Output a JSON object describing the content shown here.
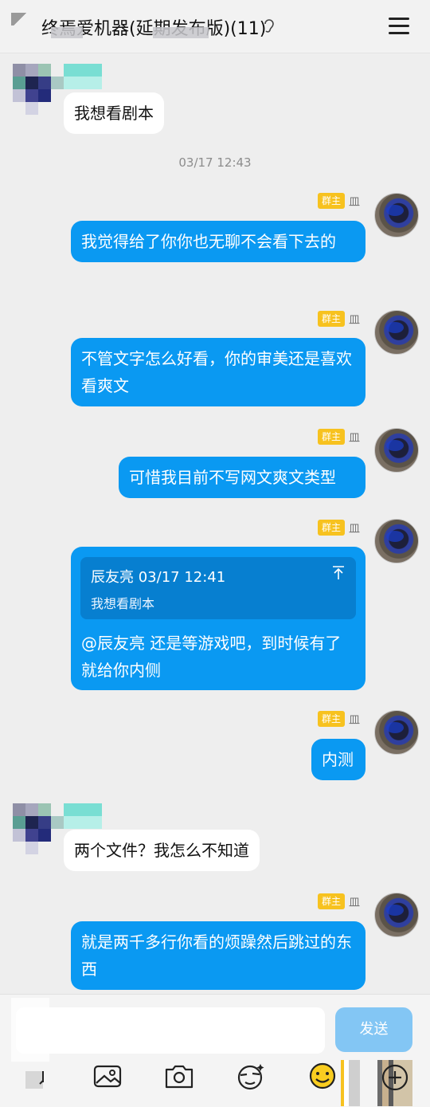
{
  "header": {
    "title": "终焉爱机器(延期发布版)(11)",
    "ear_icon": "ear-icon",
    "menu_icon": "hamburger-menu-icon"
  },
  "timestamp": "03/17 12:43",
  "owner_badge": "群主",
  "owner_nick": "皿",
  "messages": [
    {
      "side": "in",
      "text": "我想看剧本"
    },
    {
      "side": "out",
      "text": "我觉得给了你你也无聊不会看下去的"
    },
    {
      "side": "out",
      "text": "不管文字怎么好看，你的审美还是喜欢看爽文"
    },
    {
      "side": "out",
      "text": "可惜我目前不写网文爽文类型"
    },
    {
      "side": "out",
      "text": "@辰友亮 还是等游戏吧，到时候有了就给你内侧",
      "quote": {
        "author_time": "辰友亮 03/17 12:41",
        "text": "我想看剧本"
      }
    },
    {
      "side": "out",
      "text": "内测"
    },
    {
      "side": "in",
      "text": "两个文件？我怎么不知道"
    },
    {
      "side": "out",
      "text": "就是两千多行你看的烦躁然后跳过的东西"
    }
  ],
  "input": {
    "placeholder": "",
    "send_label": "发送"
  },
  "toolbar": [
    "voice-icon",
    "image-icon",
    "camera-icon",
    "sticker-icon",
    "emoji-icon",
    "plus-icon"
  ],
  "colors": {
    "bubble_out": "#0a99f2",
    "badge": "#f7c21f",
    "send": "#83c6f4"
  }
}
